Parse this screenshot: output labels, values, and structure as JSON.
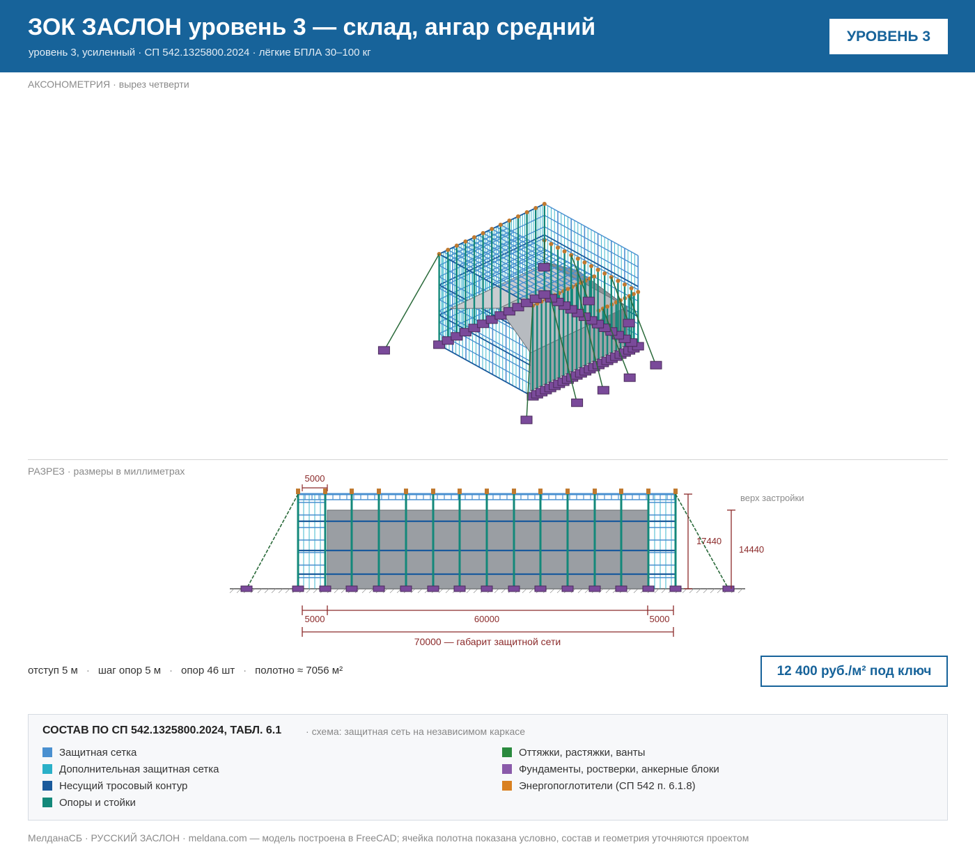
{
  "header": {
    "title": "ЗОК ЗАСЛОН уровень 3 — склад, ангар средний",
    "subtitle": "уровень 3, усиленный · СП 542.1325800.2024 · лёгкие БПЛА 30–100 кг",
    "badge": "УРОВЕНЬ 3"
  },
  "axonometry": {
    "label": "АКСОНОМЕТРИЯ",
    "note": "вырез четверти"
  },
  "section": {
    "label": "РАЗРЕЗ",
    "note": "размеры в миллиметрах",
    "top_bay": "5000",
    "building_top_label": "верх застройки",
    "net_height": "17440",
    "building_height": "14440",
    "dim_left": "5000",
    "dim_mid": "60000",
    "dim_right": "5000",
    "overall": "70000 — габарит защитной сети"
  },
  "params": {
    "offset": "отступ 5 м",
    "pitch": "шаг опор 5 м",
    "count": "опор 46 шт",
    "area": "полотно ≈ 7056 м²"
  },
  "price": "12 400 руб./м² под ключ",
  "legend": {
    "title": "СОСТАВ ПО СП 542.1325800.2024, ТАБЛ. 6.1",
    "note": "схема: защитная сеть на независимом каркасе",
    "items": [
      {
        "label": "Защитная сетка",
        "color": "#4a90d0"
      },
      {
        "label": "Дополнительная защитная сетка",
        "color": "#2ab0c8"
      },
      {
        "label": "Несущий тросовый контур",
        "color": "#1a5a9c"
      },
      {
        "label": "Опоры и стойки",
        "color": "#13887a"
      },
      {
        "label": "Оттяжки, растяжки, ванты",
        "color": "#2a8a3e"
      },
      {
        "label": "Фундаменты, ростверки, анкерные блоки",
        "color": "#8a5aaa"
      },
      {
        "label": "Энергопоглотители (СП 542 п. 6.1.8)",
        "color": "#d98020"
      }
    ]
  },
  "footer": "МелданаСБ · РУССКИЙ ЗАСЛОН · meldana.com — модель построена в FreeCAD; ячейка полотна показана условно, состав и геометрия уточняются проектом"
}
